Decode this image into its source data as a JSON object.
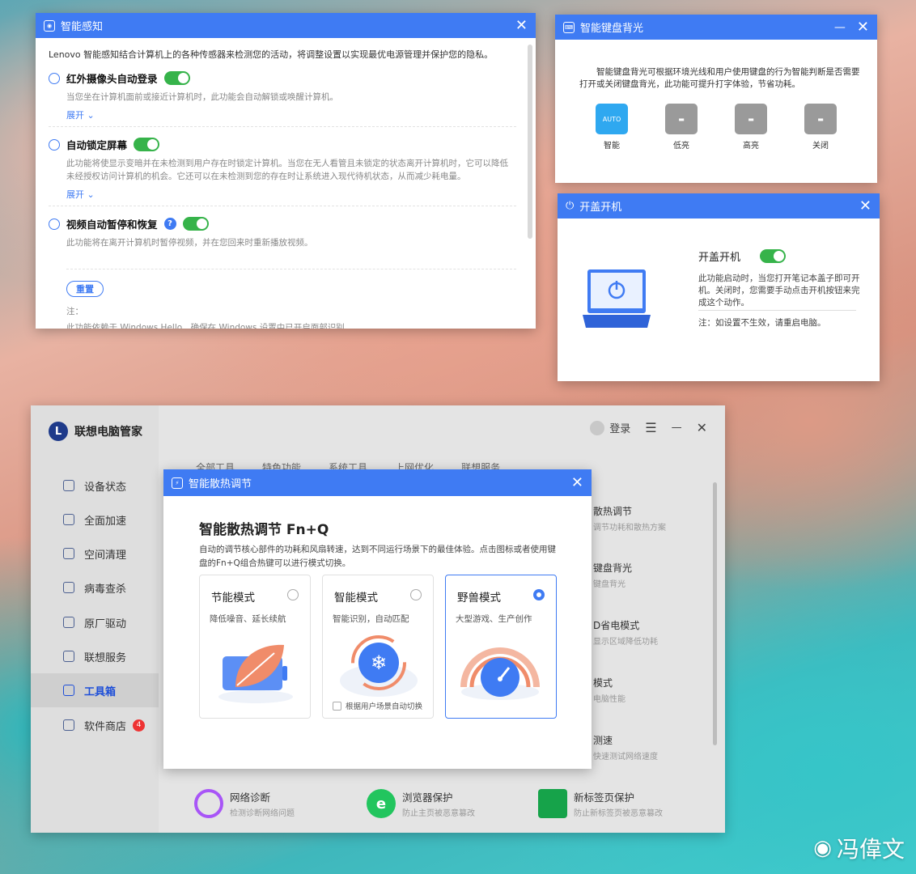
{
  "ambient": {
    "title": "智能感知",
    "intro": "Lenovo 智能感知结合计算机上的各种传感器来检测您的活动，将调整设置以实现最优电源管理并保护您的隐私。",
    "sections": [
      {
        "title": "红外摄像头自动登录",
        "desc": "当您坐在计算机面前或接近计算机时，此功能会自动解锁或唤醒计算机。",
        "expand": "展开 ⌄",
        "enabled": true
      },
      {
        "title": "自动锁定屏幕",
        "desc": "此功能将使显示变暗并在未检测到用户存在时锁定计算机。当您在无人看管且未锁定的状态离开计算机时，它可以降低未经授权访问计算机的机会。它还可以在未检测到您的存在时让系统进入现代待机状态，从而减少耗电量。",
        "expand": "展开 ⌄",
        "enabled": true
      },
      {
        "title": "视频自动暂停和恢复",
        "desc": "此功能将在离开计算机时暂停视频，并在您回来时重新播放视频。",
        "help": "?",
        "enabled": true
      }
    ],
    "reset": "重置",
    "note_label": "注：",
    "note_text": "此功能依赖于 Windows Hello，确保在 Windows 设置中已开启面部识别"
  },
  "keyboard": {
    "title": "智能键盘背光",
    "desc": "智能键盘背光可根据环境光线和用户使用键盘的行为智能判断是否需要打开或关闭键盘背光，此功能可提升打字体验，节省功耗。",
    "options": [
      {
        "label": "智能",
        "icon": "auto-backlight-icon",
        "text": "AUTO",
        "selected": true
      },
      {
        "label": "低亮",
        "icon": "low-backlight-icon",
        "selected": false
      },
      {
        "label": "高亮",
        "icon": "high-backlight-icon",
        "selected": false
      },
      {
        "label": "关闭",
        "icon": "backlight-off-icon",
        "selected": false
      }
    ]
  },
  "lid": {
    "title": "开盖开机",
    "feature": "开盖开机",
    "enabled": true,
    "desc": "此功能启动时，当您打开笔记本盖子即可开机。关闭时，您需要手动点击开机按钮来完成这个动作。",
    "note": "注：如设置不生效，请重启电脑。"
  },
  "app": {
    "name": "联想电脑管家",
    "logo_letter": "L",
    "login": "登录",
    "nav": [
      {
        "label": "设备状态",
        "icon": "device-status-icon"
      },
      {
        "label": "全面加速",
        "icon": "rocket-icon"
      },
      {
        "label": "空间清理",
        "icon": "broom-icon"
      },
      {
        "label": "病毒查杀",
        "icon": "shield-icon"
      },
      {
        "label": "原厂驱动",
        "icon": "driver-icon"
      },
      {
        "label": "联想服务",
        "icon": "headset-icon"
      },
      {
        "label": "工具箱",
        "icon": "toolbox-icon",
        "active": true
      },
      {
        "label": "软件商店",
        "icon": "store-icon",
        "badge": "4"
      }
    ],
    "tabs": [
      "全部工具",
      "特色功能",
      "系统工具",
      "上网优化",
      "联想服务"
    ],
    "right_items": [
      {
        "title": "散热调节",
        "sub": "调节功耗和散热方案"
      },
      {
        "title": "键盘背光",
        "sub": "键盘背光"
      },
      {
        "title": "D省电模式",
        "sub": "显示区域降低功耗"
      },
      {
        "title": "模式",
        "sub": "电脑性能"
      },
      {
        "title": "测速",
        "sub": "快速测试网络速度"
      }
    ],
    "bottom_tools": [
      {
        "title": "网络诊断",
        "sub": "检测诊断网络问题",
        "color": "#a855f7"
      },
      {
        "title": "浏览器保护",
        "sub": "防止主页被恶意篡改",
        "color": "#22c55e"
      },
      {
        "title": "新标签页保护",
        "sub": "防止新标签页被恶意篡改",
        "color": "#16a34a"
      }
    ]
  },
  "thermal": {
    "title": "智能散热调节",
    "heading": "智能散热调节 Fn+Q",
    "desc": "自动的调节核心部件的功耗和风扇转速，达到不同运行场景下的最佳体验。点击图标或者使用键盘的Fn+Q组合热键可以进行模式切换。",
    "modes": [
      {
        "name": "节能模式",
        "sub": "降低噪音、延长续航",
        "selected": false
      },
      {
        "name": "智能模式",
        "sub": "智能识别，自动匹配",
        "selected": false,
        "checkbox": "根据用户场景自动切换"
      },
      {
        "name": "野兽模式",
        "sub": "大型游戏、生产创作",
        "selected": true
      }
    ]
  },
  "watermark": "冯偉文",
  "colors": {
    "accent": "#3f7bf3",
    "toggle_on": "#36b34a",
    "app_active": "#1d4ed8",
    "badge": "#e33333"
  }
}
